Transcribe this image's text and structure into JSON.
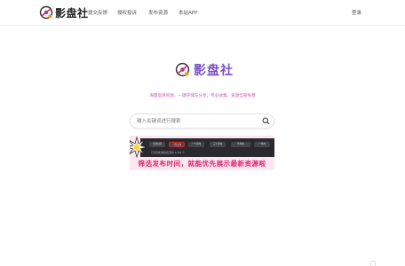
{
  "header": {
    "brand": "影盘社",
    "nav": [
      "提交反馈",
      "侵权投诉",
      "发布资源",
      "本站APP"
    ],
    "login": "登录"
  },
  "hero": {
    "brand": "影盘社",
    "tagline": "海量高清资源，一键存储与分享，专业收集，资源全部免费"
  },
  "search": {
    "placeholder": "输入关键词进行搜索",
    "value": ""
  },
  "banner": {
    "caption": "筛选发布时间，就能优先展示最新资源啦",
    "shot_tabs": [
      "全部时间",
      "一周之内",
      "一个月内",
      "三个月内",
      "半年内",
      "一年内"
    ],
    "shot_line": "已为您找到相关结果约 2,143 个"
  },
  "colors": {
    "brand_purple": "#7a4fc9",
    "tagline_pink": "#cc55bb",
    "banner_red": "#e0286e"
  },
  "icons": {
    "logo": "brand-logo-icon",
    "search": "search-icon"
  }
}
